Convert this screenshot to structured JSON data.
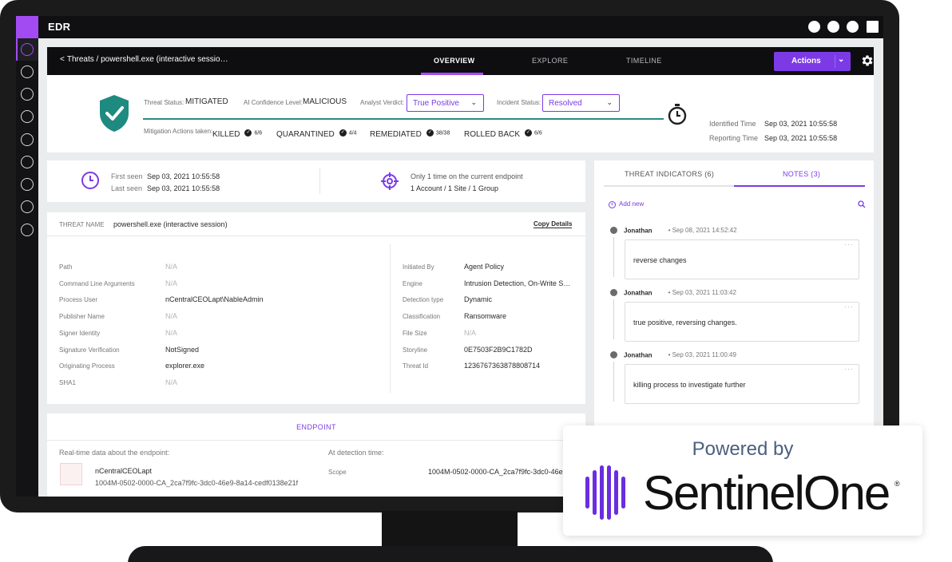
{
  "app": {
    "title": "EDR"
  },
  "topbar": {
    "breadcrumb": "Threats / powershell.exe (interactive sessio…",
    "tabs": [
      {
        "label": "OVERVIEW",
        "active": true
      },
      {
        "label": "EXPLORE",
        "active": false
      },
      {
        "label": "TIMELINE",
        "active": false
      }
    ],
    "actions_label": "Actions"
  },
  "summary": {
    "threat_status_label": "Threat Status:",
    "threat_status_value": "MITIGATED",
    "ai_confidence_label": "AI Confidence Level:",
    "ai_confidence_value": "MALICIOUS",
    "analyst_verdict_label": "Analyst Verdict:",
    "analyst_verdict_value": "True Positive",
    "incident_status_label": "Incident Status:",
    "incident_status_value": "Resolved",
    "mitigation_label": "Mitigation Actions taken:",
    "mitigations": [
      {
        "label": "KILLED",
        "count": "6/6"
      },
      {
        "label": "QUARANTINED",
        "count": "4/4"
      },
      {
        "label": "REMEDIATED",
        "count": "38/38"
      },
      {
        "label": "ROLLED BACK",
        "count": "6/6"
      }
    ],
    "identified_time_label": "Identified Time",
    "identified_time_value": "Sep 03, 2021 10:55:58",
    "reporting_time_label": "Reporting Time",
    "reporting_time_value": "Sep 03, 2021 10:55:58"
  },
  "seen": {
    "first_seen_label": "First seen",
    "first_seen_value": "Sep 03, 2021 10:55:58",
    "last_seen_label": "Last seen",
    "last_seen_value": "Sep 03, 2021 10:55:58",
    "scope_line1": "Only 1 time on the current endpoint",
    "scope_line2": "1 Account / 1 Site / 1 Group"
  },
  "details": {
    "threat_name_label": "THREAT NAME",
    "threat_name_value": "powershell.exe (interactive session)",
    "copy_label": "Copy Details",
    "left": [
      {
        "k": "Path",
        "v": "N/A",
        "na": true
      },
      {
        "k": "Command Line Arguments",
        "v": "N/A",
        "na": true
      },
      {
        "k": "Process User",
        "v": "nCentralCEOLapt\\NableAdmin",
        "na": false
      },
      {
        "k": "Publisher Name",
        "v": "N/A",
        "na": true
      },
      {
        "k": "Signer Identity",
        "v": "N/A",
        "na": true
      },
      {
        "k": "Signature Verification",
        "v": "NotSigned",
        "na": false
      },
      {
        "k": "Originating Process",
        "v": "explorer.exe",
        "na": false
      },
      {
        "k": "SHA1",
        "v": "N/A",
        "na": true
      }
    ],
    "right": [
      {
        "k": "Initiated By",
        "v": "Agent Policy",
        "na": false
      },
      {
        "k": "Engine",
        "v": "Intrusion Detection, On-Write S…",
        "na": false
      },
      {
        "k": "Detection type",
        "v": "Dynamic",
        "na": false
      },
      {
        "k": "Classification",
        "v": "Ransomware",
        "na": false
      },
      {
        "k": "File Size",
        "v": "N/A",
        "na": true
      },
      {
        "k": "Storyline",
        "v": "0E7503F2B9C1782D",
        "na": false
      },
      {
        "k": "Threat Id",
        "v": "1236767363878808714",
        "na": false
      }
    ]
  },
  "endpoint": {
    "title": "ENDPOINT",
    "realtime_label": "Real-time data about the endpoint:",
    "detection_label": "At detection time:",
    "name": "nCentralCEOLapt",
    "id": "1004M-0502-0000-CA_2ca7f9fc-3dc0-46e9-8a14-cedf0138e21f",
    "scope_label": "Scope",
    "scope_value": "1004M-0502-0000-CA_2ca7f9fc-3dc0-46e"
  },
  "notes_panel": {
    "tab_indicators": "THREAT INDICATORS (6)",
    "tab_notes": "NOTES (3)",
    "add_new": "Add new",
    "notes": [
      {
        "author": "Jonathan",
        "time": "• Sep 08, 2021 14:52:42",
        "text": "reverse changes"
      },
      {
        "author": "Jonathan",
        "time": "• Sep 03, 2021 11:03:42",
        "text": "true positive, reversing changes."
      },
      {
        "author": "Jonathan",
        "time": "• Sep 03, 2021 11:00:49",
        "text": "killing process to investigate further"
      }
    ]
  },
  "badge": {
    "powered_by": "Powered by",
    "brand": "SentinelOne",
    "registered": "®"
  },
  "colors": {
    "accent": "#7c3ae6",
    "brand_purple": "#a34bf2",
    "shield_teal": "#1f8a7f"
  }
}
